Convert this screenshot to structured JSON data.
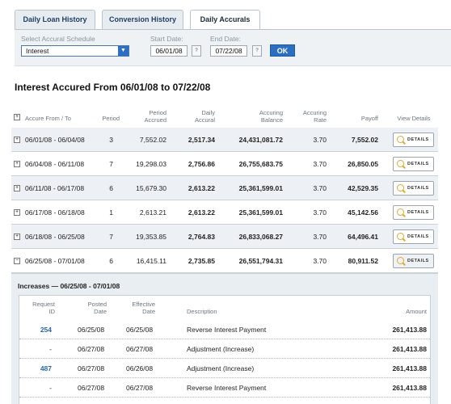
{
  "tabs": [
    {
      "label": "Daily Loan History",
      "active": false
    },
    {
      "label": "Conversion History",
      "active": false
    },
    {
      "label": "Daily Accurals",
      "active": true
    }
  ],
  "filter": {
    "schedule_label": "Select Accural Schedule",
    "schedule_value": "Interest",
    "start_label": "Start Date:",
    "start_value": "06/01/08",
    "end_label": "End Date:",
    "end_value": "07/22/08",
    "ok_label": "OK"
  },
  "heading": "Interest Accured From 06/01/08 to 07/22/08",
  "table": {
    "headers": {
      "accrue": "Accure From / To",
      "period": "Period",
      "period_accrued": [
        "Period",
        "Accrued"
      ],
      "daily_accrual": [
        "Daily",
        "Accural"
      ],
      "balance": [
        "Accuring",
        "Balance"
      ],
      "rate": [
        "Accuring",
        "Rate"
      ],
      "payoff": "Payoff",
      "view": "View Details"
    },
    "details_label": "DETAILS",
    "rows": [
      {
        "range": "06/01/08 - 06/04/08",
        "period": "3",
        "accrued": "7,552.02",
        "daily": "2,517.34",
        "balance": "24,431,081.72",
        "rate": "3.70",
        "payoff": "7,552.02",
        "toggle": "+"
      },
      {
        "range": "06/04/08 - 06/11/08",
        "period": "7",
        "accrued": "19,298.03",
        "daily": "2,756.86",
        "balance": "26,755,683.75",
        "rate": "3.70",
        "payoff": "26,850.05",
        "toggle": "+"
      },
      {
        "range": "06/11/08 - 06/17/08",
        "period": "6",
        "accrued": "15,679.30",
        "daily": "2,613.22",
        "balance": "25,361,599.01",
        "rate": "3.70",
        "payoff": "42,529.35",
        "toggle": "+"
      },
      {
        "range": "06/17/08 - 06/18/08",
        "period": "1",
        "accrued": "2,613.21",
        "daily": "2,613.22",
        "balance": "25,361,599.01",
        "rate": "3.70",
        "payoff": "45,142.56",
        "toggle": "+"
      },
      {
        "range": "06/18/08 - 06/25/08",
        "period": "7",
        "accrued": "19,353.85",
        "daily": "2,764.83",
        "balance": "26,833,068.27",
        "rate": "3.70",
        "payoff": "64,496.41",
        "toggle": "+"
      },
      {
        "range": "06/25/08 - 07/01/08",
        "period": "6",
        "accrued": "16,415.11",
        "daily": "2,735.85",
        "balance": "26,551,794.31",
        "rate": "3.70",
        "payoff": "80,911.52",
        "toggle": "−"
      }
    ]
  },
  "increases": {
    "title": "Increases — 06/25/08 - 07/01/08",
    "headers": {
      "request_id": [
        "Request",
        "ID"
      ],
      "posted": [
        "Posted",
        "Date"
      ],
      "effective": [
        "Effective",
        "Date"
      ],
      "description": "Description",
      "amount": "Amount"
    },
    "rows": [
      {
        "id": "254",
        "posted": "06/25/08",
        "effective": "06/25/08",
        "description": "Reverse Interest Payment",
        "amount": "261,413.88",
        "link": true
      },
      {
        "id": "-",
        "posted": "06/27/08",
        "effective": "06/27/08",
        "description": "Adjustment (Increase)",
        "amount": "261,413.88",
        "link": false
      },
      {
        "id": "487",
        "posted": "06/27/08",
        "effective": "06/26/08",
        "description": "Adjustment (Increase)",
        "amount": "261,413.88",
        "link": true
      },
      {
        "id": "-",
        "posted": "06/27/08",
        "effective": "06/27/08",
        "description": "Reverse Interest Payment",
        "amount": "261,413.88",
        "link": false
      },
      {
        "id": "-",
        "posted": "06/28/08",
        "effective": "06/28/08",
        "description": "Reverse Interest Payment",
        "amount": "261,413.88",
        "link": false
      }
    ]
  }
}
